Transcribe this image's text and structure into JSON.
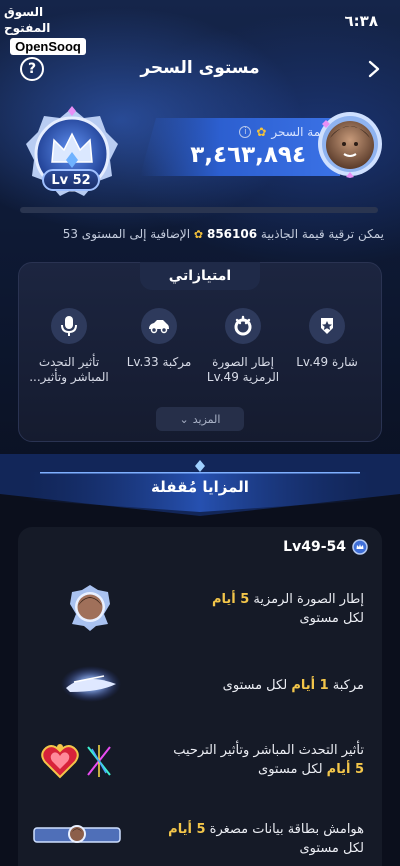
{
  "watermark": {
    "arabic": "السوق المفتوح",
    "english": "OpenSooq"
  },
  "status_bar": {
    "time": "٦:٣٨"
  },
  "header": {
    "title": "مستوى السحر",
    "help_label": "?"
  },
  "level": {
    "badge": "Lv 52",
    "value_label": "قيمة السحر",
    "value": "٣,٤٦٣,٨٩٤"
  },
  "upgrade": {
    "prefix": "يمكن ترقية قيمة الجاذبية",
    "amount": "856106",
    "suffix": "الإضافية إلى المستوى 53"
  },
  "privileges": {
    "tab_label": "امتيازاتي",
    "items": [
      {
        "label": "شارة Lv.49",
        "icon": "badge-icon"
      },
      {
        "label": "إطار الصورة الرمزية Lv.49",
        "icon": "avatar-frame-icon"
      },
      {
        "label": "مركبة Lv.33",
        "icon": "car-icon"
      },
      {
        "label": "تأثير التحدث المباشر وتأثير...",
        "icon": "microphone-icon"
      }
    ],
    "more_label": "المزيد"
  },
  "locked": {
    "title": "المزايا مُقفلة",
    "range": "Lv49-54",
    "rows": [
      {
        "pre": "إطار الصورة الرمزية",
        "highlight": "5 أيام",
        "post": "لكل مستوى",
        "icon": "avatar-frame-preview-icon"
      },
      {
        "pre": "مركبة",
        "highlight": "1 أيام",
        "post": "لكل مستوى",
        "icon": "vehicle-preview-icon"
      },
      {
        "pre": "تأثير التحدث المباشر وتأثير الترحيب",
        "highlight": "5 أيام",
        "post": "لكل مستوى",
        "icon": "mic-effect-preview-icon"
      },
      {
        "pre": "هوامش بطاقة بيانات مصغرة",
        "highlight": "5 أيام",
        "post": "لكل مستوى",
        "icon": "profile-card-preview-icon"
      }
    ]
  },
  "colors": {
    "accent": "#3b72e6",
    "gold": "#f3c64a",
    "background": "#0b0f1c"
  }
}
